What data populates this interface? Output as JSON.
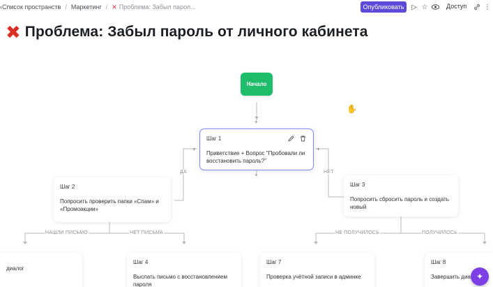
{
  "breadcrumb": {
    "items": [
      "Список пространств",
      "Маркетинг",
      "Проблема: Забыл парол..."
    ]
  },
  "toolbar": {
    "publish_label": "Опубликовать",
    "access_label": "Доступ"
  },
  "page": {
    "title": "Проблема: Забыл пароль от личного кабинета"
  },
  "flow": {
    "start_label": "Начало",
    "step1": {
      "title": "Шаг 1",
      "text": "Приветствие + Вопрос \"Пробовали ли восстановить пароль?\""
    },
    "step2": {
      "title": "Шаг 2",
      "text": "Попросить проверить папки «Спам» и «Промоакции»"
    },
    "step3": {
      "title": "Шаг 3",
      "text": "Попросить сбросить пароль и создать новый"
    },
    "step_left": {
      "title": "",
      "text": "диалог"
    },
    "step4": {
      "title": "Шаг 4",
      "text": "Выслать письмо с восстановлением пароля"
    },
    "step7": {
      "title": "Шаг 7",
      "text": "Проверка учётной записи в админке"
    },
    "step8": {
      "title": "Шаг 8",
      "text": "Завершить диа"
    },
    "labels": {
      "yes": "ДА",
      "no": "НЕТ",
      "found_mail": "НАШЛИ ПИСЬМО",
      "no_mail": "НЕТ ПИСЬМА",
      "not_worked": "НЕ ПОЛУЧИЛОСЬ",
      "worked": "ПОЛУЧИЛОСЬ"
    },
    "plus": "+"
  },
  "colors": {
    "accent": "#5b4bd8",
    "start_node": "#1fbd6a",
    "error_x": "#d93025",
    "fab": "#7b3fe4"
  }
}
